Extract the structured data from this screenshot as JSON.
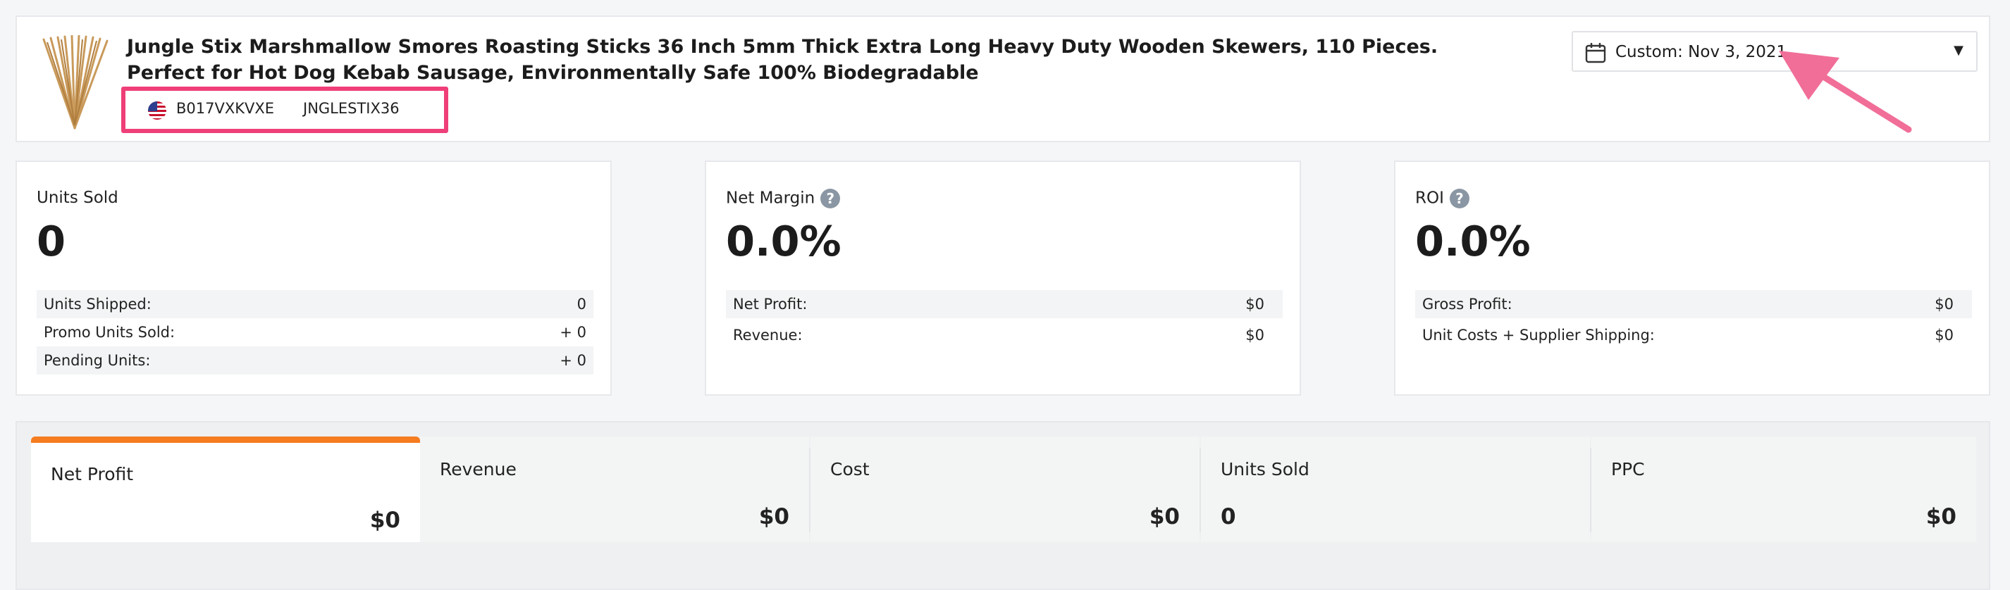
{
  "product": {
    "title": "Jungle Stix Marshmallow Smores Roasting Sticks 36 Inch 5mm Thick Extra Long Heavy Duty Wooden Skewers, 110 Pieces. Perfect for Hot Dog Kebab Sausage, Environmentally Safe 100% Biodegradable",
    "asin": "B017VXKVXE",
    "sku": "JNGLESTIX36",
    "marketplace_icon": "us-flag-icon"
  },
  "date_filter": {
    "label": "Custom: Nov 3, 2021",
    "icon": "calendar-icon"
  },
  "cards": {
    "units": {
      "title": "Units Sold",
      "value": "0",
      "rows": [
        {
          "k": "Units Shipped:",
          "v": "0"
        },
        {
          "k": "Promo Units Sold:",
          "v": "+ 0"
        },
        {
          "k": "Pending Units:",
          "v": "+ 0"
        }
      ]
    },
    "margin": {
      "title": "Net Margin",
      "value": "0.0%",
      "help": "?",
      "rows": [
        {
          "k": "Net Profit:",
          "v": "$0"
        },
        {
          "k": "Revenue:",
          "v": "$0"
        }
      ]
    },
    "roi": {
      "title": "ROI",
      "value": "0.0%",
      "help": "?",
      "rows": [
        {
          "k": "Gross Profit:",
          "v": "$0"
        },
        {
          "k": "Unit Costs + Supplier Shipping:",
          "v": "$0"
        }
      ]
    }
  },
  "tabs": [
    {
      "label": "Net Profit",
      "value": "$0"
    },
    {
      "label": "Revenue",
      "value": "$0"
    },
    {
      "label": "Cost",
      "value": "$0"
    },
    {
      "label": "Units Sold",
      "value": "0"
    },
    {
      "label": "PPC",
      "value": "$0"
    }
  ],
  "colors": {
    "accent": "#f57c1f",
    "highlight": "#ef3f78",
    "help_icon": "#8a96a3"
  }
}
